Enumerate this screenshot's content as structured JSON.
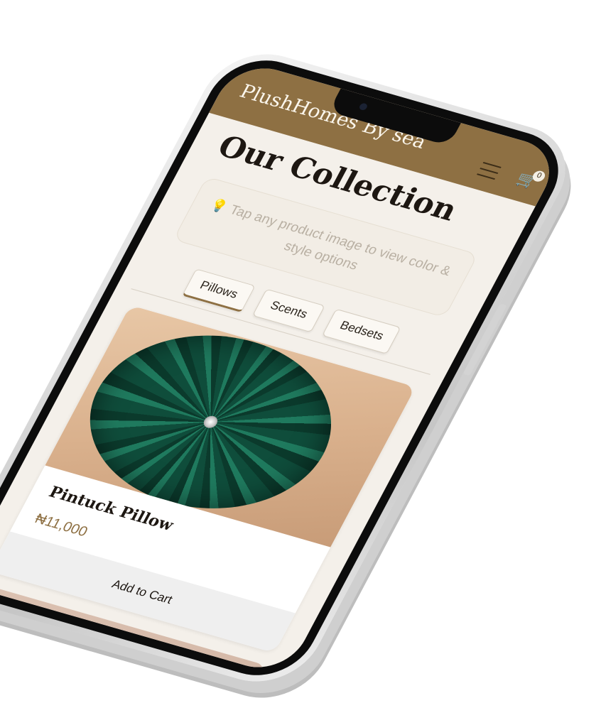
{
  "header": {
    "brand": "PlushHomes By sea",
    "menu_icon": "hamburger-menu-icon",
    "cart_icon": "cart-icon",
    "cart_count": "0"
  },
  "page": {
    "title": "Our Collection",
    "hint_icon": "lightbulb-icon",
    "hint_text": "Tap any product image to view color & style options"
  },
  "tabs": [
    {
      "label": "Pillows",
      "active": true
    },
    {
      "label": "Scents",
      "active": false
    },
    {
      "label": "Bedsets",
      "active": false
    }
  ],
  "products": [
    {
      "name": "Pintuck Pillow",
      "price": "₦11,000",
      "button_label": "Add to Cart"
    }
  ],
  "colors": {
    "header_bg": "#8e7043",
    "page_bg": "#f4f0ea",
    "accent": "#8e7043"
  }
}
